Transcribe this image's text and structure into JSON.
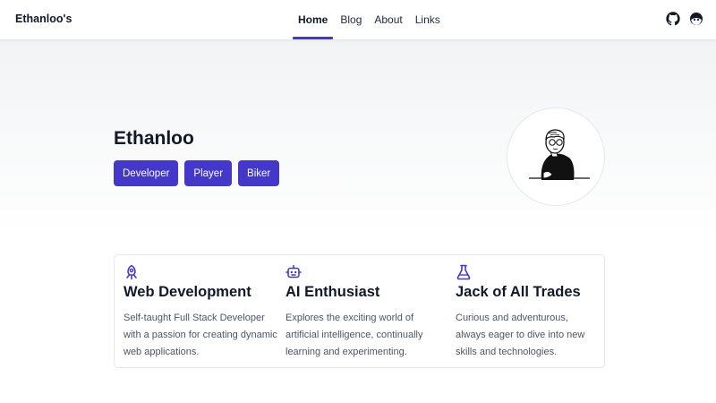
{
  "header": {
    "logo": "Ethanloo's",
    "nav": [
      {
        "label": "Home",
        "active": true
      },
      {
        "label": "Blog",
        "active": false
      },
      {
        "label": "About",
        "active": false
      },
      {
        "label": "Links",
        "active": false
      }
    ],
    "icons": [
      "github-icon",
      "theme-toggle-icon"
    ]
  },
  "hero": {
    "name": "Ethanloo",
    "tags": [
      "Developer",
      "Player",
      "Biker"
    ],
    "avatar_icon": "avatar-illustration"
  },
  "features": [
    {
      "icon": "rocket-icon",
      "title": "Web Development",
      "description": "Self-taught Full Stack Developer with a passion for creating dynamic web applications."
    },
    {
      "icon": "robot-icon",
      "title": "AI Enthusiast",
      "description": "Explores the exciting world of artificial intelligence, continually learning and experimenting."
    },
    {
      "icon": "flask-icon",
      "title": "Jack of All Trades",
      "description": "Curious and adventurous, always eager to dive into new skills and technologies."
    }
  ],
  "colors": {
    "accent": "#4338ca",
    "text": "#111827",
    "muted": "#4b5563",
    "hero_bg_top": "#f2f3f5"
  }
}
